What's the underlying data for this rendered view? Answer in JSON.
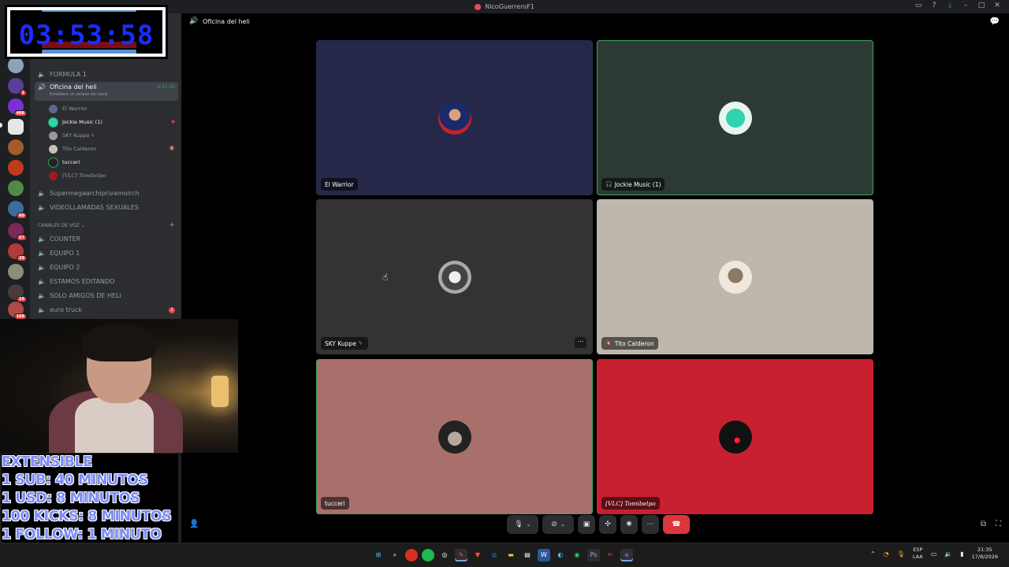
{
  "window": {
    "title": "NicoGuerreroF1",
    "accent": "#e84a5f"
  },
  "timer": {
    "value": "03:53:58",
    "digit_color": "#1a2cff"
  },
  "servers": [
    {
      "badge": "1"
    },
    {
      "badge": "406"
    },
    {
      "badge": ""
    },
    {
      "badge": ""
    },
    {
      "badge": ""
    },
    {
      "badge": ""
    },
    {
      "badge": "60"
    },
    {
      "badge": "57"
    },
    {
      "badge": "29"
    },
    {
      "badge": ""
    },
    {
      "badge": "16"
    },
    {
      "badge": "168"
    }
  ],
  "sidebar": {
    "channels_top": [
      {
        "label": "FORMULA 1"
      }
    ],
    "active_channel": {
      "label": "Oficina del heli",
      "time": "4:43:39",
      "status": "Establece un estado de canal"
    },
    "members": [
      {
        "name": "El Warrior"
      },
      {
        "name": "Jockie Music (1)"
      },
      {
        "name": "SKY Kuppe"
      },
      {
        "name": "Tito Calderon"
      },
      {
        "name": "tucceri"
      },
      {
        "name": "[VLC] Tomibelpo"
      }
    ],
    "channels_mid": [
      {
        "label": "Supermegaarchiprivamoirch"
      },
      {
        "label": "VIDEOLLAMADAS SEXUALES"
      }
    ],
    "category": "CANALES DE VOZ",
    "channels_voice": [
      {
        "label": "COUNTER"
      },
      {
        "label": "EQUIPO 1"
      },
      {
        "label": "EQUIPO 2"
      },
      {
        "label": "ESTAMOS EDITANDO"
      },
      {
        "label": "SOLO AMIGOS DE HELI"
      },
      {
        "label": "euro truck",
        "badge": "2"
      }
    ]
  },
  "overlay": {
    "lines": [
      "EXTENSIBLE",
      "1 SUB: 40 MINUTOS",
      "1 USD: 8 MINUTOS",
      "100 KICKS: 8 MINUTOS",
      "1 FOLLOW: 1 MINUTO"
    ]
  },
  "call": {
    "channel_name": "Oficina del heli",
    "tiles": [
      {
        "name": "El Warrior",
        "bg": "#26284a"
      },
      {
        "name": "Jockie Music (1)",
        "bg": "#2c3a33"
      },
      {
        "name": "SKY Kuppe",
        "bg": "#333333"
      },
      {
        "name": "Tito Calderon",
        "bg": "#bdb7ac"
      },
      {
        "name": "tucceri",
        "bg": "#a9706b"
      },
      {
        "name": "[VLC] Tomibelpo",
        "bg": "#c9202f"
      }
    ]
  },
  "taskbar": {
    "lang_top": "ESP",
    "lang_bottom": "LAA",
    "time": "21:35",
    "date": "17/8/2026"
  }
}
